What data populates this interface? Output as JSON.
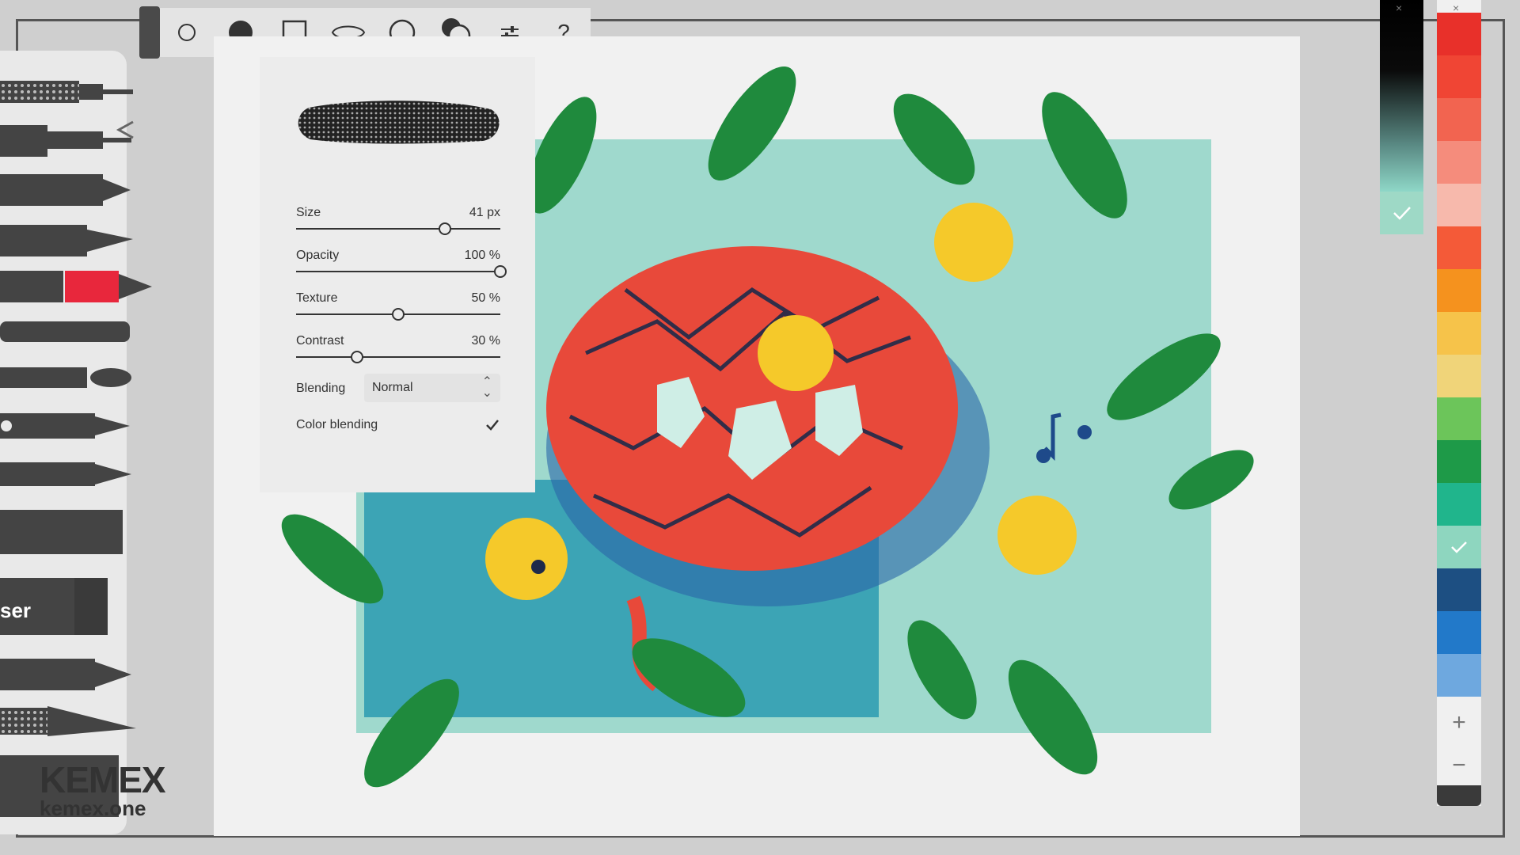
{
  "toolbar": {
    "tools": [
      "circle-outline-icon",
      "circle-filled-icon",
      "square-outline-icon",
      "lasso-icon",
      "ellipse-outline-icon",
      "color-blend-circles-icon",
      "sliders-icon",
      "help-icon"
    ],
    "help_label": "?"
  },
  "brush_settings": {
    "size": {
      "label": "Size",
      "value": "41 px",
      "level": 0.73
    },
    "opacity": {
      "label": "Opacity",
      "value": "100 %",
      "level": 1.0
    },
    "texture": {
      "label": "Texture",
      "value": "50 %",
      "level": 0.5
    },
    "contrast": {
      "label": "Contrast",
      "value": "30 %",
      "level": 0.3
    },
    "blending": {
      "label": "Blending",
      "value": "Normal"
    },
    "color_blending": {
      "label": "Color blending",
      "checked": true
    }
  },
  "brushes": [
    "fineliner",
    "technical-pen",
    "marker-chisel",
    "marker-wide",
    "marker-red",
    "crayon",
    "brush",
    "pencil-eraser",
    "fountain-pen",
    "airbrush",
    "eraser",
    "pencil-soft",
    "charcoal",
    "ruler"
  ],
  "brush_eraser_label": "ser",
  "palette": {
    "colors": [
      "#e8302a",
      "#f04534",
      "#f26450",
      "#f58c7c",
      "#f7b9ac",
      "#f45a38",
      "#f5921e",
      "#f6c34a",
      "#f0d479",
      "#6cc55a",
      "#1e9a48",
      "#20b58c",
      "#8ed6bf",
      "#1d4f82",
      "#2279c9",
      "#6ea8df"
    ],
    "selected_index": 12,
    "add_label": "+",
    "remove_label": "−"
  },
  "gradient_confirm": "check-icon",
  "watermark": {
    "line1": "KEMEX",
    "line2": "kemex.one"
  }
}
